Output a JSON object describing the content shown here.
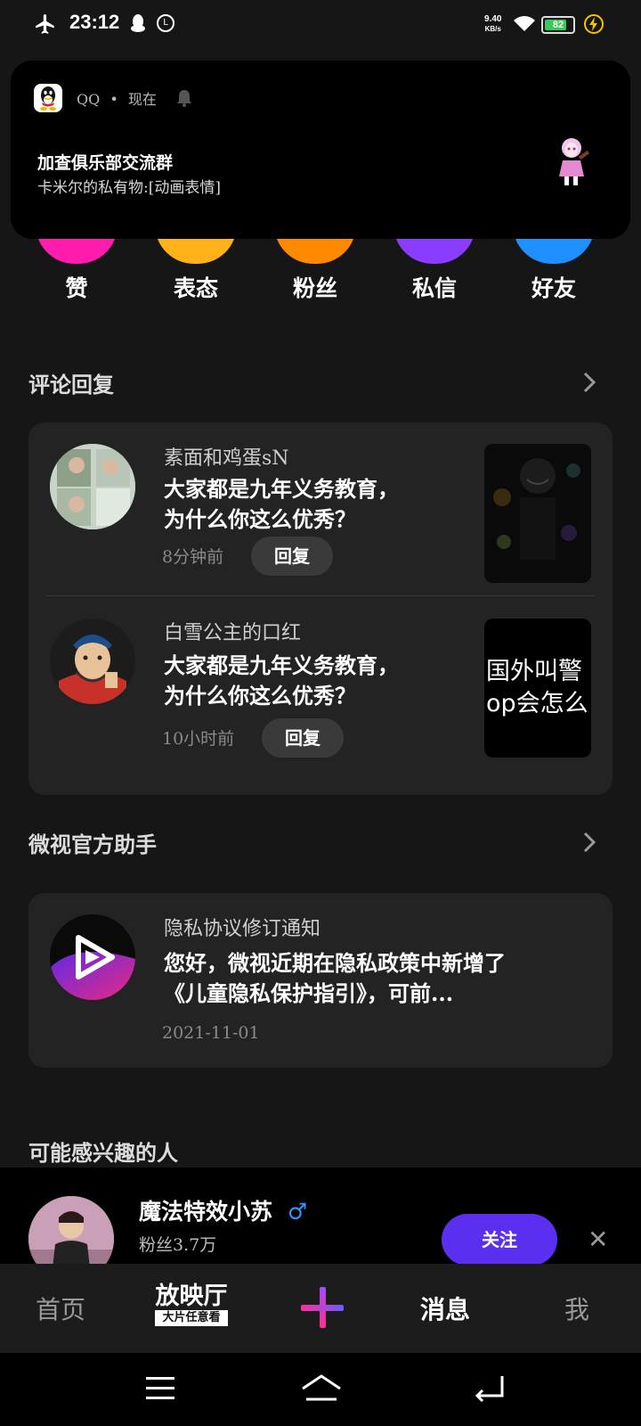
{
  "status_bar": {
    "time": "23:12",
    "net_speed_value": "9.40",
    "net_speed_unit": "KB/s",
    "battery": "82",
    "battery_level": 0.82
  },
  "notification": {
    "app": "QQ",
    "separator": "•",
    "time": "现在",
    "title": "加查俱乐部交流群",
    "body": "卡米尔的私有物:[动画表情]"
  },
  "categories": [
    {
      "label": "赞",
      "color": "#ff1cae"
    },
    {
      "label": "表态",
      "color": "#ffb21a"
    },
    {
      "label": "粉丝",
      "color": "#ff8a00"
    },
    {
      "label": "私信",
      "color": "#8a3cff"
    },
    {
      "label": "好友",
      "color": "#1e90ff"
    }
  ],
  "comments_section": {
    "title": "评论回复",
    "items": [
      {
        "user": "素面和鸡蛋sN",
        "text_line1": "大家都是九年义务教育，",
        "text_line2": "为什么你这么优秀？",
        "time": "8分钟前",
        "reply_label": "回复"
      },
      {
        "user": "白雪公主的口红",
        "text_line1": "大家都是九年义务教育，",
        "text_line2": "为什么你这么优秀？",
        "time": "10小时前",
        "reply_label": "回复",
        "thumb_text_line1": "国外叫警",
        "thumb_text_line2": "op会怎么"
      }
    ]
  },
  "official_section": {
    "title": "微视官方助手",
    "item": {
      "title": "隐私协议修订通知",
      "text_line1": "您好，微视近期在隐私政策中新增了",
      "text_line2": "《儿童隐私保护指引》，可前...",
      "date": "2021-11-01"
    }
  },
  "suggest_section": {
    "title": "可能感兴趣的人",
    "user": {
      "name": "魔法特效小苏",
      "gender_symbol": "♂",
      "fans": "粉丝3.7万",
      "follow_label": "关注",
      "close_symbol": "✕"
    }
  },
  "tabbar": {
    "home": "首页",
    "theater_top": "放映厅",
    "theater_bottom": "大片任意看",
    "plus": "+",
    "messages": "消息",
    "me": "我"
  },
  "colors": {
    "accent": "#5b2ff0",
    "background": "#161616",
    "card": "#232323"
  }
}
